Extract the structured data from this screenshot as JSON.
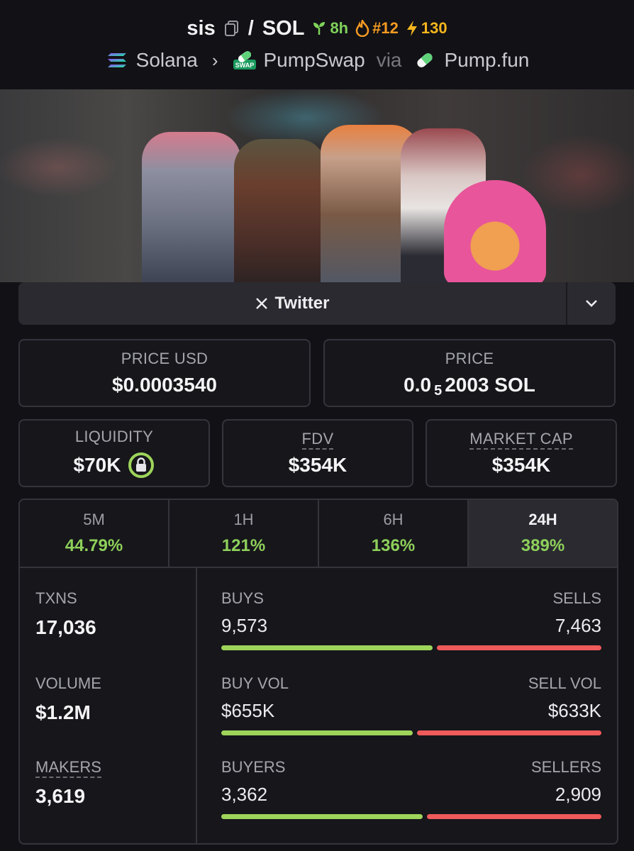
{
  "header": {
    "token": "sis",
    "quote": "SOL",
    "age": "8h",
    "rank": "#12",
    "boosts": "130",
    "chain": "Solana",
    "dex": "PumpSwap",
    "via": "via",
    "launchpad": "Pump.fun",
    "dex_badge_text": "SWAP"
  },
  "twitter": {
    "label": "Twitter"
  },
  "stats": {
    "price_usd": {
      "label": "PRICE USD",
      "value": "$0.0003540"
    },
    "price": {
      "label": "PRICE",
      "prefix": "0.0",
      "subscript": "5",
      "suffix": "2003 SOL"
    },
    "liquidity": {
      "label": "LIQUIDITY",
      "value": "$70K"
    },
    "fdv": {
      "label": "FDV",
      "value": "$354K"
    },
    "market_cap": {
      "label": "MARKET CAP",
      "value": "$354K"
    }
  },
  "tabs": [
    {
      "label": "5M",
      "value": "44.79%"
    },
    {
      "label": "1H",
      "value": "121%"
    },
    {
      "label": "6H",
      "value": "136%"
    },
    {
      "label": "24H",
      "value": "389%",
      "active": true
    }
  ],
  "metrics": {
    "txns": {
      "label": "TXNS",
      "value": "17,036"
    },
    "volume": {
      "label": "VOLUME",
      "value": "$1.2M"
    },
    "makers": {
      "label": "MAKERS",
      "value": "3,619"
    }
  },
  "splits": {
    "txns": {
      "left_label": "BUYS",
      "right_label": "SELLS",
      "left_value": "9,573",
      "right_value": "7,463",
      "buy_ratio": 0.562
    },
    "volume": {
      "left_label": "BUY VOL",
      "right_label": "SELL VOL",
      "left_value": "$655K",
      "right_value": "$633K",
      "buy_ratio": 0.509
    },
    "makers": {
      "left_label": "BUYERS",
      "right_label": "SELLERS",
      "left_value": "3,362",
      "right_value": "2,909",
      "buy_ratio": 0.536
    }
  },
  "colors": {
    "green": "#9ed45a",
    "red": "#ef5a5a",
    "gain": "#8ed05a",
    "background": "#111116"
  }
}
